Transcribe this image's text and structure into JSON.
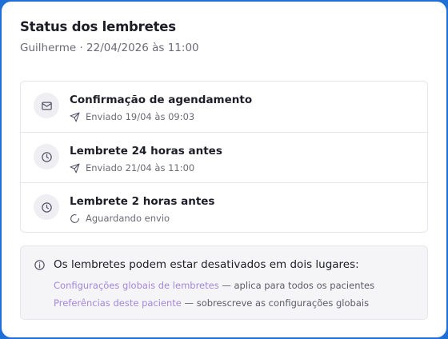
{
  "header": {
    "title": "Status dos lembretes",
    "subtitle": "Guilherme · 22/04/2026 às 11:00"
  },
  "reminders": [
    {
      "icon": "mail-icon",
      "title": "Confirmação de agendamento",
      "status_icon": "send-icon",
      "status": "Enviado 19/04 às 09:03"
    },
    {
      "icon": "clock-icon",
      "title": "Lembrete 24 horas antes",
      "status_icon": "send-icon",
      "status": "Enviado 21/04 às 11:00"
    },
    {
      "icon": "clock-icon",
      "title": "Lembrete 2 horas antes",
      "status_icon": "loading-icon",
      "status": "Aguardando envio"
    }
  ],
  "info": {
    "text": "Os lembretes podem estar desativados em dois lugares:",
    "links": [
      {
        "label": "Configurações globais de lembretes",
        "desc": " — aplica para todos os pacientes"
      },
      {
        "label": "Preferências deste paciente",
        "desc": " — sobrescreve as configurações globais"
      }
    ]
  },
  "colors": {
    "link": "#a487d8",
    "background": "#1f6fd6"
  }
}
